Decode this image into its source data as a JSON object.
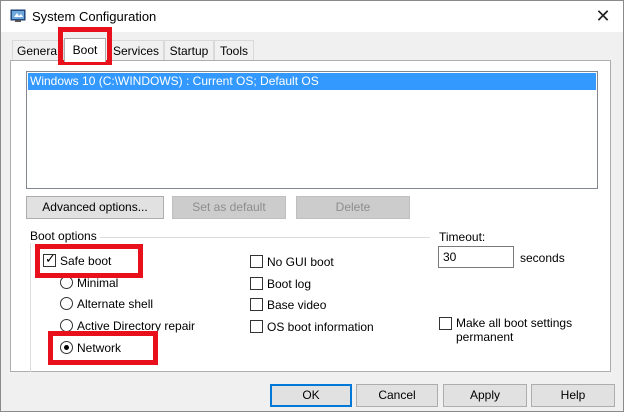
{
  "window": {
    "title": "System Configuration",
    "close_glyph": "✕",
    "icon": "msconfig-icon"
  },
  "tabs": [
    {
      "label": "General",
      "visible_text": "Genera"
    },
    {
      "label": "Boot",
      "active": true
    },
    {
      "label": "Services"
    },
    {
      "label": "Startup"
    },
    {
      "label": "Tools"
    }
  ],
  "os_list": {
    "items": [
      "Windows 10 (C:\\WINDOWS) : Current OS; Default OS"
    ],
    "selected_index": 0
  },
  "os_buttons": {
    "advanced": "Advanced options...",
    "set_default": "Set as default",
    "delete": "Delete"
  },
  "boot_options": {
    "label": "Boot options",
    "safe_boot": {
      "label": "Safe boot",
      "checked": true
    },
    "minimal": {
      "label": "Minimal",
      "selected": false
    },
    "alternate_shell": {
      "label": "Alternate shell",
      "selected": false
    },
    "ad_repair": {
      "label": "Active Directory repair",
      "selected": false
    },
    "network": {
      "label": "Network",
      "selected": true
    },
    "no_gui_boot": {
      "label": "No GUI boot",
      "checked": false
    },
    "boot_log": {
      "label": "Boot log",
      "checked": false
    },
    "base_video": {
      "label": "Base video",
      "checked": false
    },
    "os_boot_info": {
      "label": "OS boot information",
      "checked": false
    }
  },
  "timeout": {
    "label": "Timeout:",
    "value": "30",
    "unit": "seconds"
  },
  "make_permanent": {
    "line1": "Make all boot settings",
    "line2": "permanent",
    "checked": false
  },
  "footer": {
    "ok": "OK",
    "cancel": "Cancel",
    "apply": "Apply",
    "help": "Help"
  },
  "colors": {
    "highlight": "#e8111b",
    "selection": "#3399ff",
    "default_button_border": "#0078d7"
  }
}
